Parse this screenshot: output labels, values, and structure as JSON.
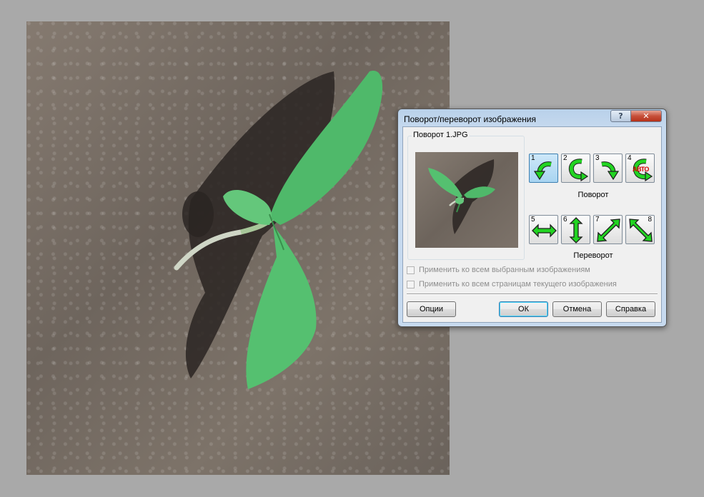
{
  "dialog": {
    "title": "Поворот/переворот изображения",
    "help_label": "?",
    "close_label": "✕",
    "group_label": "Поворот 1.JPG",
    "rotate_caption": "Поворот",
    "flip_caption": "Переворот",
    "rotate_tools": [
      {
        "num": "1",
        "icon": "rotate-left-icon"
      },
      {
        "num": "2",
        "icon": "rotate-180-icon"
      },
      {
        "num": "3",
        "icon": "rotate-right-icon"
      },
      {
        "num": "4",
        "icon": "auto-rotate-icon",
        "badge": "АВТО"
      }
    ],
    "flip_tools": [
      {
        "num": "5",
        "icon": "flip-horizontal-icon"
      },
      {
        "num": "6",
        "icon": "flip-vertical-icon"
      },
      {
        "num": "7",
        "icon": "flip-diagonal-icon"
      },
      {
        "num": "8",
        "icon": "flip-antidiagonal-icon"
      }
    ],
    "checkboxes": [
      {
        "label": "Применить ко всем выбранным изображениям",
        "checked": false,
        "enabled": false
      },
      {
        "label": "Применить ко всем страницам текущего изображения",
        "checked": false,
        "enabled": false
      }
    ],
    "buttons": {
      "options": "Опции",
      "ok": "ОК",
      "cancel": "Отмена",
      "help": "Справка"
    }
  },
  "colors": {
    "arrow_green": "#22d422",
    "active_tool": "#a8d4f1",
    "close_red": "#c6503a"
  }
}
